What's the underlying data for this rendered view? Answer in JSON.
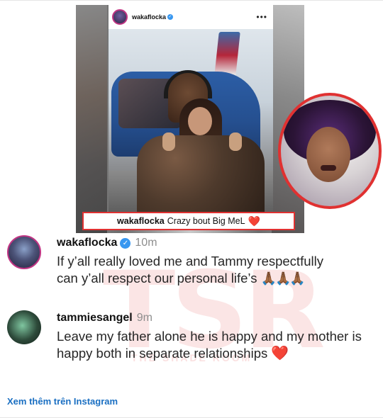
{
  "post": {
    "username": "wakaflocka",
    "verified_glyph": "✓",
    "more_glyph": "•••",
    "caption_user": "wakaflocka",
    "caption_text": "Crazy bout Big MeL",
    "caption_emoji": "❤️"
  },
  "comments": [
    {
      "username": "wakaflocka",
      "verified_glyph": "✓",
      "time": "10m",
      "text": "If y’all really loved me and Tammy respectfully can y’all respect our personal life’s",
      "emoji": "🙏🏾🙏🏾🙏🏾"
    },
    {
      "username": "tammiesangel",
      "time": "9m",
      "text": "Leave my father alone he is happy and my mother is happy both in separate relationships",
      "emoji": "❤️"
    }
  ],
  "watermark": {
    "main": "TSR",
    "sub": "THE SHADE ROOM"
  },
  "footer": {
    "link_label": "Xem thêm trên Instagram"
  },
  "colors": {
    "accent_red": "#e03131",
    "link_blue": "#1a6fc2",
    "verified_blue": "#3897f0"
  },
  "icons": [
    "verified-badge-icon",
    "more-options-icon",
    "heart-emoji",
    "praying-hands-emoji"
  ]
}
